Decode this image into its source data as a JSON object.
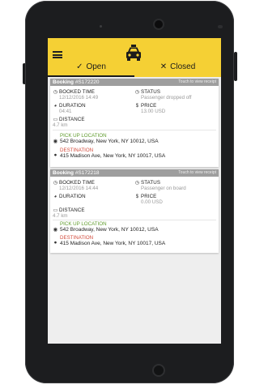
{
  "app": {
    "tabs": {
      "open": {
        "glyph": "✓",
        "label": "Open"
      },
      "closed": {
        "glyph": "✕",
        "label": "Closed"
      }
    },
    "icons": {
      "menu": "hamburger-menu-icon",
      "logo": "taxi-icon"
    },
    "colors": {
      "accent": "#f5d034",
      "card_header": "#9e9e9e",
      "pickup": "#5f9b2c",
      "destination": "#d24b3c"
    }
  },
  "labels": {
    "booking": "Booking",
    "hint": "Touch to view receipt",
    "booked_time": "BOOKED TIME",
    "status": "STATUS",
    "duration": "DURATION",
    "price": "PRICE",
    "distance": "DISTANCE",
    "pickup": "PICK UP LOCATION",
    "destination": "DESTINATION",
    "price_symbol": "$"
  },
  "bookings": [
    {
      "number": "#S172220",
      "booked_time": "12/12/2016 14:49",
      "status": "Passenger dropped off",
      "duration": "04:41",
      "price": "13.00 USD",
      "distance": "4.7 km",
      "pickup": "542 Broadway, New York, NY 10012, USA",
      "destination": "415 Madison Ave, New York, NY 10017, USA"
    },
    {
      "number": "#S172218",
      "booked_time": "12/12/2016 14:44",
      "status": "Passenger on board",
      "duration": "",
      "price": "0.00 USD",
      "distance": "4.7 km",
      "pickup": "542 Broadway, New York, NY 10012, USA",
      "destination": "415 Madison Ave, New York, NY 10017, USA"
    }
  ]
}
